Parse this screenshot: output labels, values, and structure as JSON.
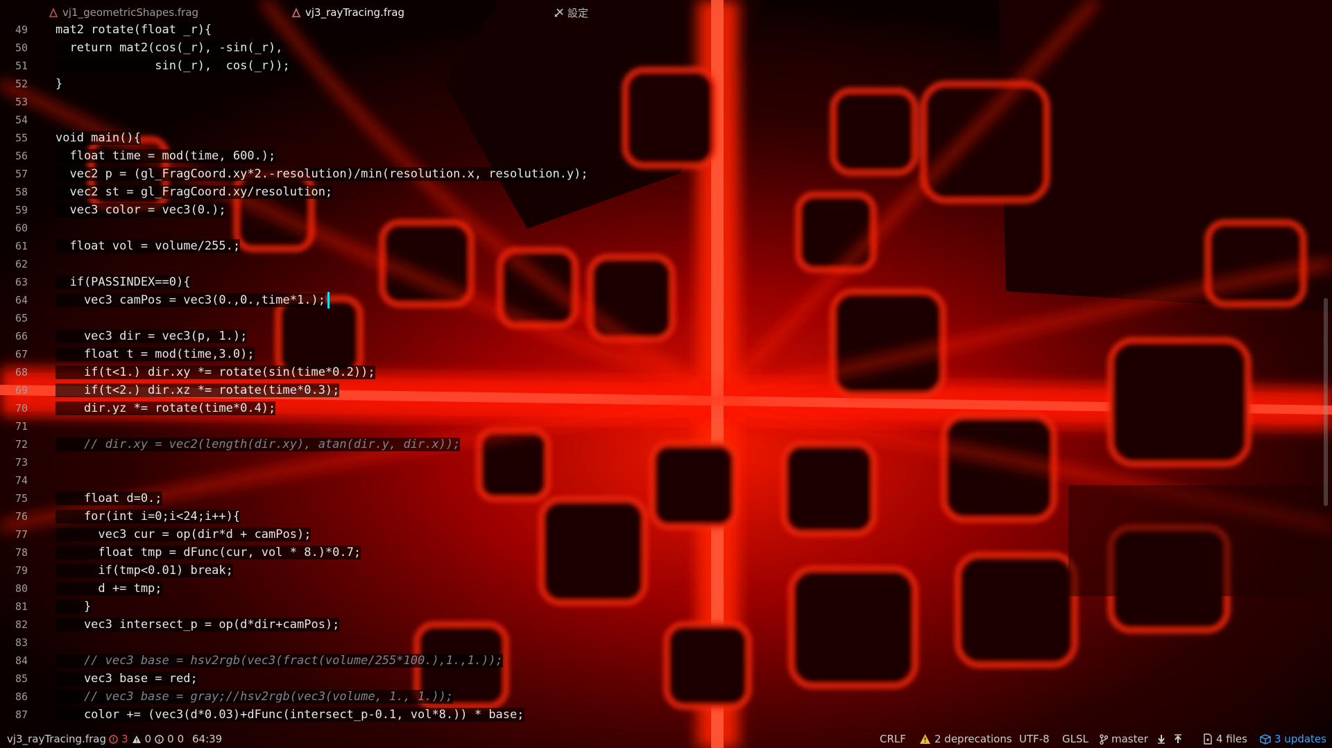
{
  "tabs": [
    {
      "label": "vj1_geometricShapes.frag",
      "active": false,
      "icon": "file-icon"
    },
    {
      "label": "vj3_rayTracing.frag",
      "active": true,
      "icon": "file-icon"
    }
  ],
  "settings_tab": {
    "label": "設定",
    "icon": "tools-icon"
  },
  "editor": {
    "first_line": 49,
    "cursor": {
      "line": 64,
      "col": 39
    },
    "lines": [
      "mat2 rotate(float _r){",
      "  return mat2(cos(_r), -sin(_r),",
      "              sin(_r),  cos(_r));",
      "}",
      "",
      "",
      "void main(){",
      "  float time = mod(time, 600.);",
      "  vec2 p = (gl_FragCoord.xy*2.-resolution)/min(resolution.x, resolution.y);",
      "  vec2 st = gl_FragCoord.xy/resolution;",
      "  vec3 color = vec3(0.);",
      "",
      "  float vol = volume/255.;",
      "",
      "  if(PASSINDEX==0){",
      "    vec3 camPos = vec3(0.,0.,time*1.);",
      "",
      "    vec3 dir = vec3(p, 1.);",
      "    float t = mod(time,3.0);",
      "    if(t<1.) dir.xy *= rotate(sin(time*0.2));",
      "    if(t<2.) dir.xz *= rotate(time*0.3);",
      "    dir.yz *= rotate(time*0.4);",
      "",
      "    // dir.xy = vec2(length(dir.xy), atan(dir.y, dir.x));",
      "",
      "",
      "    float d=0.;",
      "    for(int i=0;i<24;i++){",
      "      vec3 cur = op(dir*d + camPos);",
      "      float tmp = dFunc(cur, vol * 8.)*0.7;",
      "      if(tmp<0.01) break;",
      "      d += tmp;",
      "    }",
      "    vec3 intersect_p = op(d*dir+camPos);",
      "",
      "    // vec3 base = hsv2rgb(vec3(fract(volume/255*100.),1.,1.));",
      "    vec3 base = red;",
      "    // vec3 base = gray;//hsv2rgb(vec3(volume, 1., 1.));",
      "    color += (vec3(d*0.03)+dFunc(intersect_p-0.1, vol*8.)) * base;"
    ]
  },
  "statusbar": {
    "file": "vj3_rayTracing.frag",
    "errors": "3",
    "warnings": "0",
    "infos": "0",
    "infos2": "0",
    "position": "64:39",
    "line_ending": "CRLF",
    "deprecations": "2 deprecations",
    "encoding": "UTF-8",
    "grammar": "GLSL",
    "branch": "master",
    "files": "4 files",
    "updates": "3 updates"
  },
  "colors": {
    "accent_red": "#ff1a1a",
    "error": "#e05050",
    "warning": "#e6c040",
    "updates": "#3ea6ff",
    "cursor": "#00e5ff"
  }
}
